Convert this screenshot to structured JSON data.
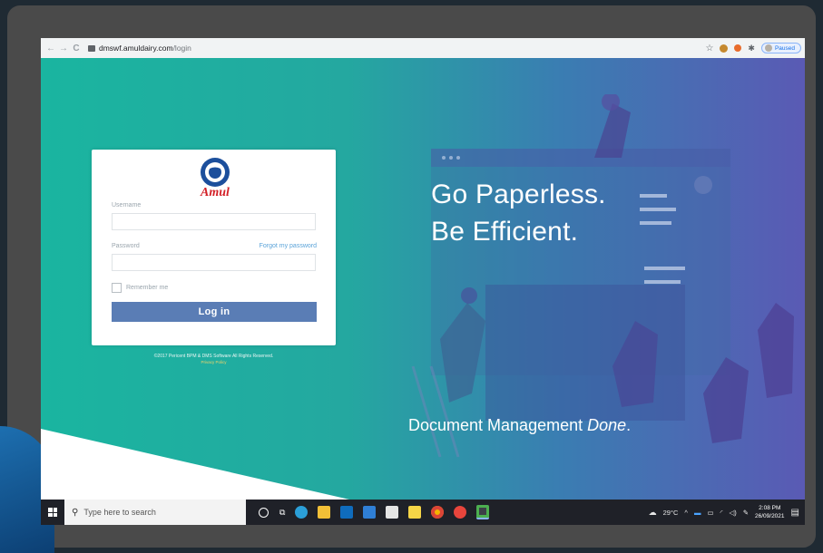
{
  "browser": {
    "back": "←",
    "forward": "→",
    "reload": "C",
    "url_host": "dmswf.amuldairy.com",
    "url_path": "/login",
    "paused_label": "Paused"
  },
  "login": {
    "logo_text": "Amul",
    "username_label": "Username",
    "password_label": "Password",
    "forgot_link": "Forgot my password",
    "remember_label": "Remember me",
    "login_button": "Log in",
    "copyright": "©2017 Pericent BPM & DMS Software All Rights Reserved.",
    "privacy": "Privacy Policy"
  },
  "hero": {
    "line1": "Go Paperless.",
    "line2": "Be Efficient.",
    "tagline_prefix": "Document Management ",
    "tagline_emphasis": "Done",
    "tagline_suffix": "."
  },
  "taskbar": {
    "search_placeholder": "Type here to search",
    "weather": "29°C",
    "time": "2:08 PM",
    "date": "26/09/2021"
  },
  "colors": {
    "teal": "#1ab5a0",
    "purple": "#5a5ab4",
    "login_button": "#5a7db5",
    "amul_red": "#d32027"
  }
}
